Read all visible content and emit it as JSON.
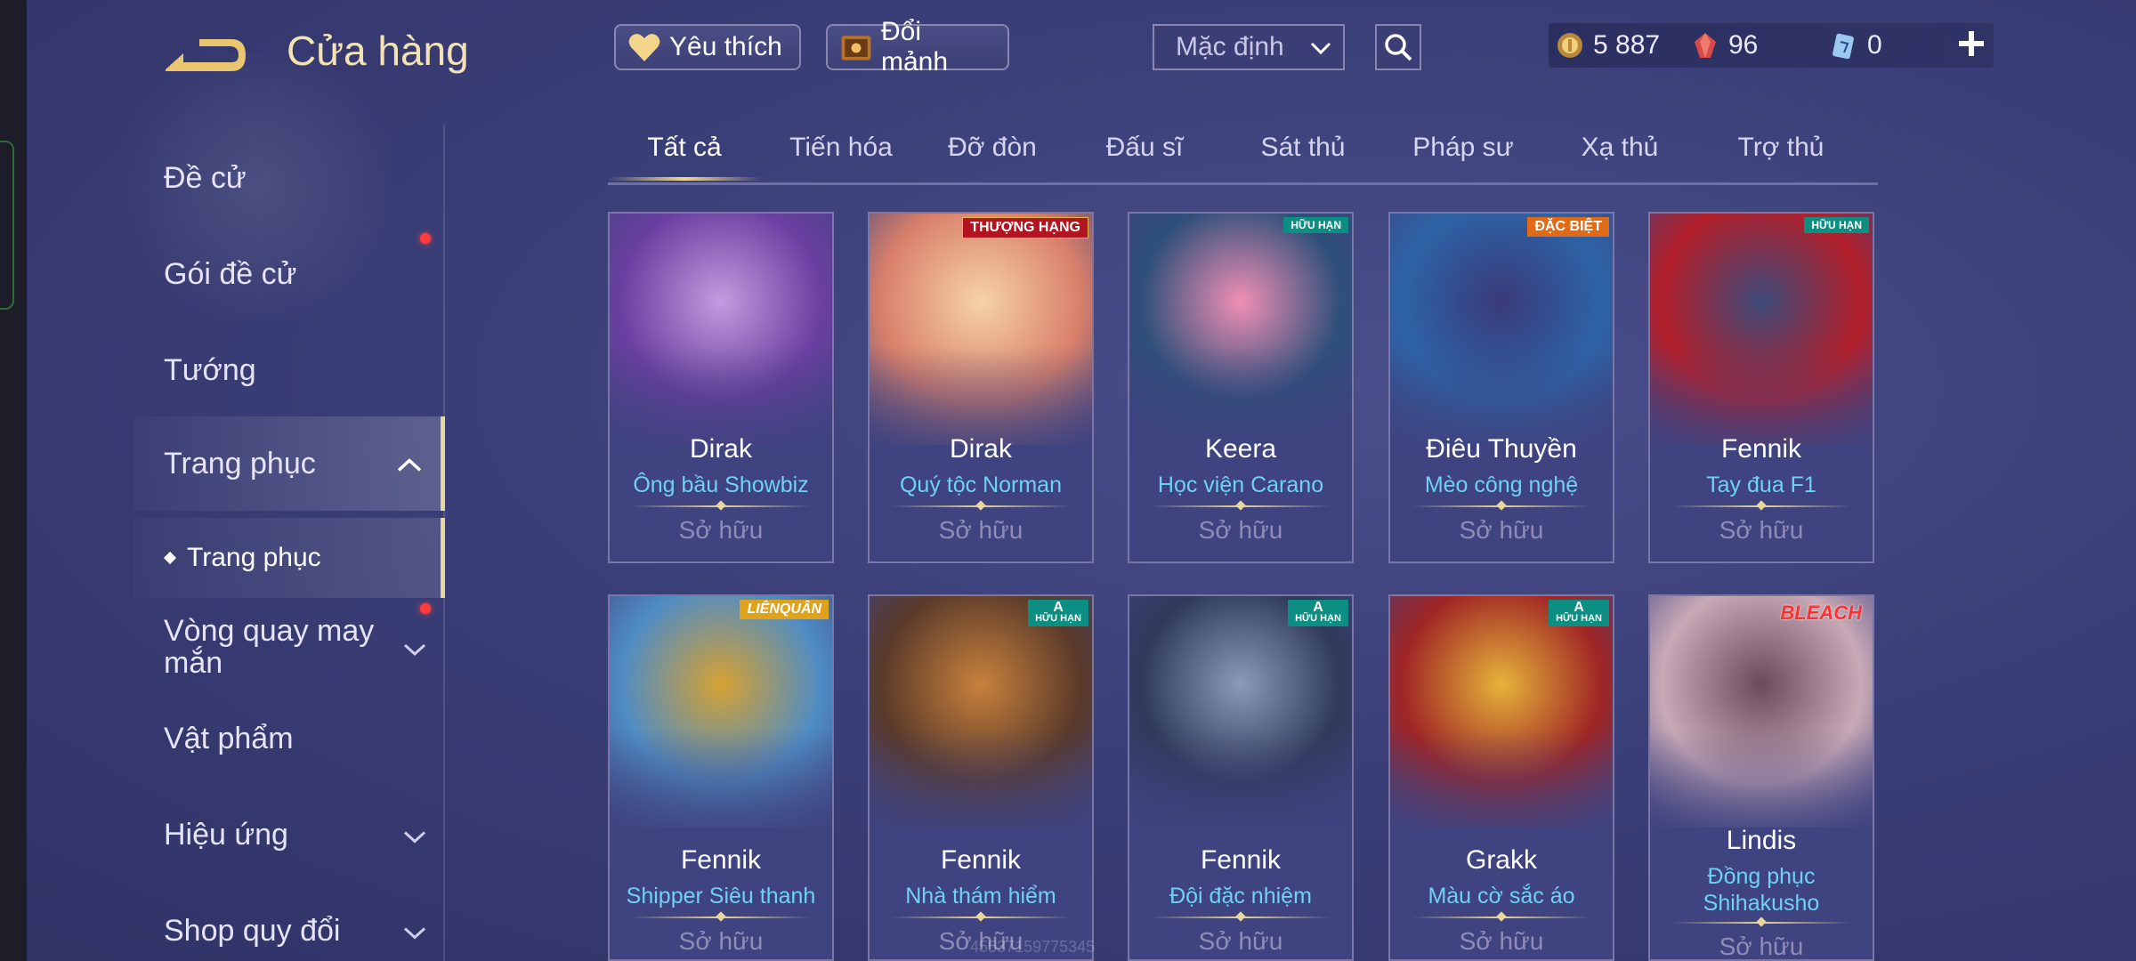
{
  "header": {
    "title": "Cửa hàng",
    "favorite_label": "Yêu thích",
    "exchange_label": "Đổi mảnh",
    "sort_value": "Mặc định",
    "currency": {
      "gold": "5 887",
      "gems": "96",
      "vouchers": "0"
    }
  },
  "sidebar": {
    "items": [
      {
        "label": "Đề cử"
      },
      {
        "label": "Gói đề cử"
      },
      {
        "label": "Tướng"
      },
      {
        "label": "Trang phục"
      },
      {
        "label": "Trang phục"
      },
      {
        "label": "Vòng quay may mắn"
      },
      {
        "label": "Vật phẩm"
      },
      {
        "label": "Hiệu ứng"
      },
      {
        "label": "Shop quy đổi"
      }
    ]
  },
  "tabs": [
    "Tất cả",
    "Tiến hóa",
    "Đỡ đòn",
    "Đấu sĩ",
    "Sát thủ",
    "Pháp sư",
    "Xạ thủ",
    "Trợ thủ"
  ],
  "badges": {
    "limited": "HỮU HẠN",
    "ranked": "THƯỢNG HẠNG",
    "special": "ĐẶC BIỆT",
    "grade_a": "A",
    "lienquan": "LIÊNQUÂN",
    "bleach": "BLEACH"
  },
  "cards": [
    {
      "hero": "Dirak",
      "skin": "Ông bầu Showbiz",
      "status": "Sở hữu",
      "colors": [
        "#6a3fa0",
        "#c49adf"
      ]
    },
    {
      "hero": "Dirak",
      "skin": "Quý tộc Norman",
      "status": "Sở hữu",
      "colors": [
        "#d9806a",
        "#f6d3a6"
      ]
    },
    {
      "hero": "Keera",
      "skin": "Học viện Carano",
      "status": "Sở hữu",
      "colors": [
        "#2f4f7a",
        "#f08fb4"
      ]
    },
    {
      "hero": "Điêu Thuyền",
      "skin": "Mèo công nghệ",
      "status": "Sở hữu",
      "colors": [
        "#2d63a6",
        "#3a3a7a"
      ]
    },
    {
      "hero": "Fennik",
      "skin": "Tay đua F1",
      "status": "Sở hữu",
      "colors": [
        "#b21f2a",
        "#3d4a7a"
      ]
    },
    {
      "hero": "Fennik",
      "skin": "Shipper Siêu thanh",
      "status": "Sở hữu",
      "colors": [
        "#4f8cc4",
        "#d6a232"
      ]
    },
    {
      "hero": "Fennik",
      "skin": "Nhà thám hiểm",
      "status": "Sở hữu",
      "colors": [
        "#5a3a2a",
        "#c8813c"
      ]
    },
    {
      "hero": "Fennik",
      "skin": "Đội đặc nhiệm",
      "status": "Sở hữu",
      "colors": [
        "#2f3a5a",
        "#8a9ab8"
      ]
    },
    {
      "hero": "Grakk",
      "skin": "Màu cờ sắc áo",
      "status": "Sở hữu",
      "colors": [
        "#a02525",
        "#e6b43a"
      ]
    },
    {
      "hero": "Lindis",
      "skin": "Đồng phục Shihakusho",
      "status": "Sở hữu",
      "colors": [
        "#c9a9b6",
        "#6b4a5a"
      ]
    }
  ],
  "watermark": "45537159775345"
}
